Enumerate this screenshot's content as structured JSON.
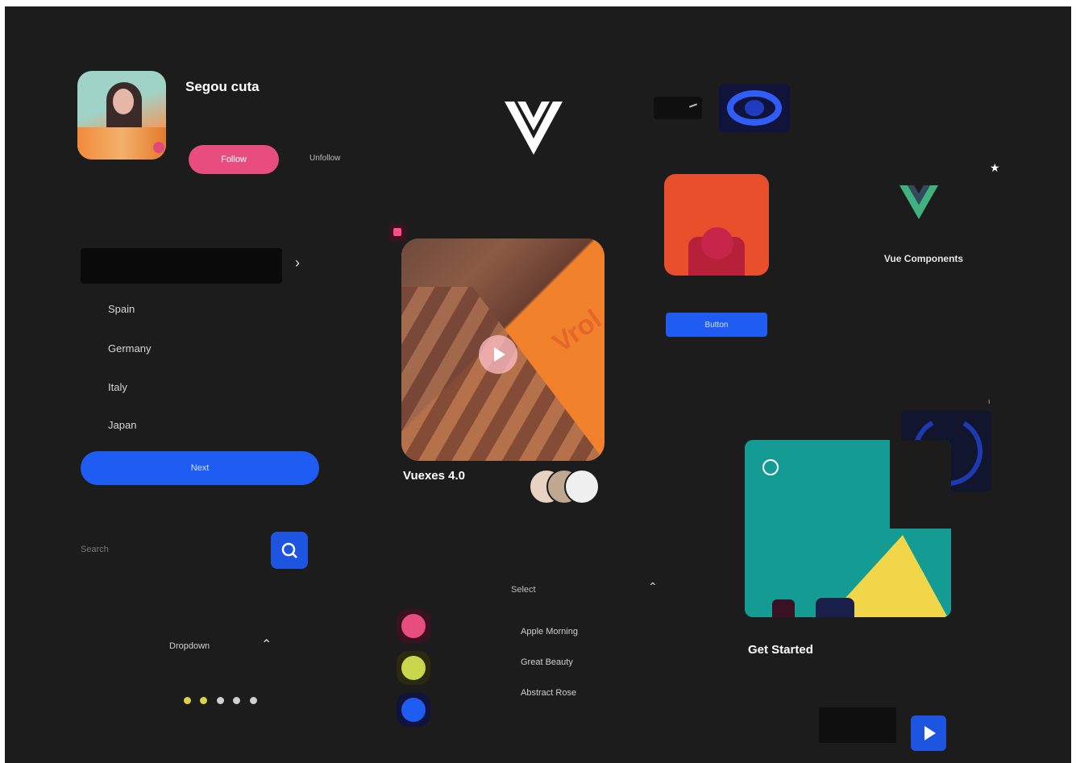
{
  "profile": {
    "name": "Segou cuta",
    "description": "",
    "follow_label": "Follow",
    "link_label": "Unfollow"
  },
  "list": {
    "select_label": "",
    "items": [
      "Spain",
      "Germany",
      "Italy",
      "Japan"
    ],
    "primary_button": "Next"
  },
  "search": {
    "placeholder": "Search"
  },
  "dropdown": {
    "label": "Dropdown"
  },
  "pagination_dots": [
    "#d9d24a",
    "#d9d24a",
    "#cfcfcf",
    "#cfcfcf",
    "#cfcfcf"
  ],
  "image_card": {
    "title": "Vuexes 4.0",
    "subtitle": "",
    "watermark": "Vrol"
  },
  "small_card": {
    "name": "",
    "button": "Button"
  },
  "vue_block": {
    "title": "Vue Components",
    "description": ""
  },
  "get_started": {
    "title": "Get Started",
    "description": "",
    "input_placeholder": ""
  },
  "select2": {
    "label": "Select",
    "options": [
      "Apple Morning",
      "Great Beauty",
      "Abstract Rose"
    ]
  },
  "social_colors": [
    "#e84d7f",
    "#c8d84a",
    "#1e5cf2"
  ],
  "colors": {
    "accent_blue": "#1e5cf2",
    "accent_pink": "#e84d7f"
  }
}
